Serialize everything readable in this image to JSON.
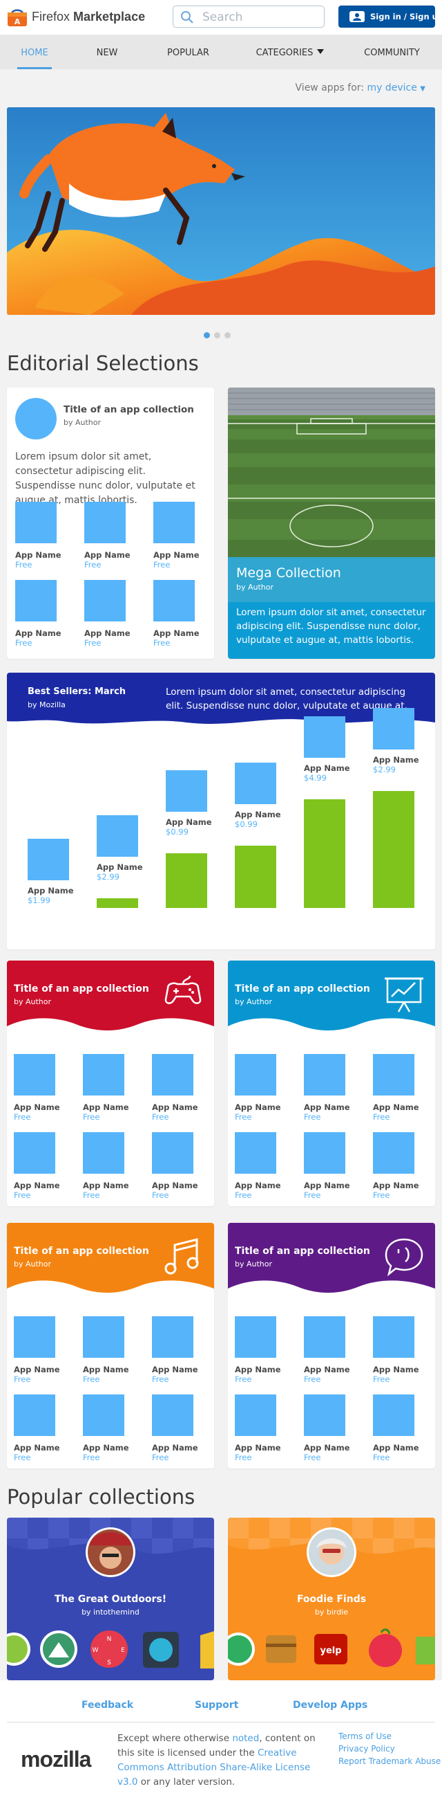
{
  "header": {
    "brand_light": "Firefox",
    "brand_bold": "Marketplace",
    "search_placeholder": "Search",
    "signin_label": "Sign in / Sign up"
  },
  "nav": {
    "tabs": [
      "HOME",
      "NEW",
      "POPULAR",
      "CATEGORIES",
      "COMMUNITY"
    ],
    "active": "HOME"
  },
  "view_apps": {
    "label": "View apps for:",
    "device": "my device"
  },
  "carousel": {
    "pages": 3,
    "active_page": 1
  },
  "editorial": {
    "title": "Editorial Selections",
    "collection": {
      "title": "Title of an app collection",
      "author": "by Author",
      "description": "Lorem ipsum dolor sit amet, consectetur adipiscing elit. Suspendisse nunc dolor, vulputate et augue at, mattis lobortis.",
      "apps": [
        {
          "name": "App Name",
          "price": "Free"
        },
        {
          "name": "App Name",
          "price": "Free"
        },
        {
          "name": "App Name",
          "price": "Free"
        },
        {
          "name": "App Name",
          "price": "Free"
        },
        {
          "name": "App Name",
          "price": "Free"
        },
        {
          "name": "App Name",
          "price": "Free"
        }
      ]
    },
    "mega": {
      "title": "Mega Collection",
      "author": "by Author",
      "description": "Lorem ipsum dolor sit amet, consectetur adipiscing elit. Suspendisse nunc dolor, vulputate et augue at, mattis lobortis."
    }
  },
  "best_sellers": {
    "title": "Best Sellers: March",
    "author": "by Mozilla",
    "description": "Lorem ipsum dolor sit amet, consectetur adipiscing elit. Suspendisse nunc dolor, vulputate et augue at.",
    "apps": [
      {
        "name": "App Name",
        "price": "$1.99",
        "rank_level": 0.0
      },
      {
        "name": "App Name",
        "price": "$2.99",
        "rank_level": 0.08
      },
      {
        "name": "App Name",
        "price": "$0.99",
        "rank_level": 0.44
      },
      {
        "name": "App Name",
        "price": "$0.99",
        "rank_level": 0.5
      },
      {
        "name": "App Name",
        "price": "$4.99",
        "rank_level": 0.87
      },
      {
        "name": "App Name",
        "price": "$2.99",
        "rank_level": 0.94
      }
    ]
  },
  "collections": [
    {
      "title": "Title of an app collection",
      "author": "by Author",
      "color": "#cb0e2b",
      "icon": "gamepad-icon"
    },
    {
      "title": "Title of an app collection",
      "author": "by Author",
      "color": "#0996d0",
      "icon": "presentation-chart-icon"
    },
    {
      "title": "Title of an app collection",
      "author": "by Author",
      "color": "#f48411",
      "icon": "music-note-icon"
    },
    {
      "title": "Title of an app collection",
      "author": "by Author",
      "color": "#5e1b87",
      "icon": "chat-wink-icon"
    }
  ],
  "collection_app": {
    "name": "App Name",
    "price": "Free"
  },
  "popular": {
    "title": "Popular collections",
    "items": [
      {
        "title": "The Great Outdoors!",
        "author": "by intothemind",
        "color": "#3f4fba"
      },
      {
        "title": "Foodie Finds",
        "author": "by birdie",
        "color": "#fb9b2f"
      }
    ]
  },
  "footer": {
    "links": [
      "Feedback",
      "Support",
      "Develop Apps"
    ],
    "logo": "mozilla",
    "license_pre": "Except where otherwise ",
    "license_noted": "noted",
    "license_mid": ", content on this site is licensed under the ",
    "license_link": "Creative Commons Attribution Share-Alike License v3.0",
    "license_post": " or any later version.",
    "legal_links": [
      "Terms of Use",
      "Privacy Policy",
      "Report Trademark Abuse"
    ]
  }
}
